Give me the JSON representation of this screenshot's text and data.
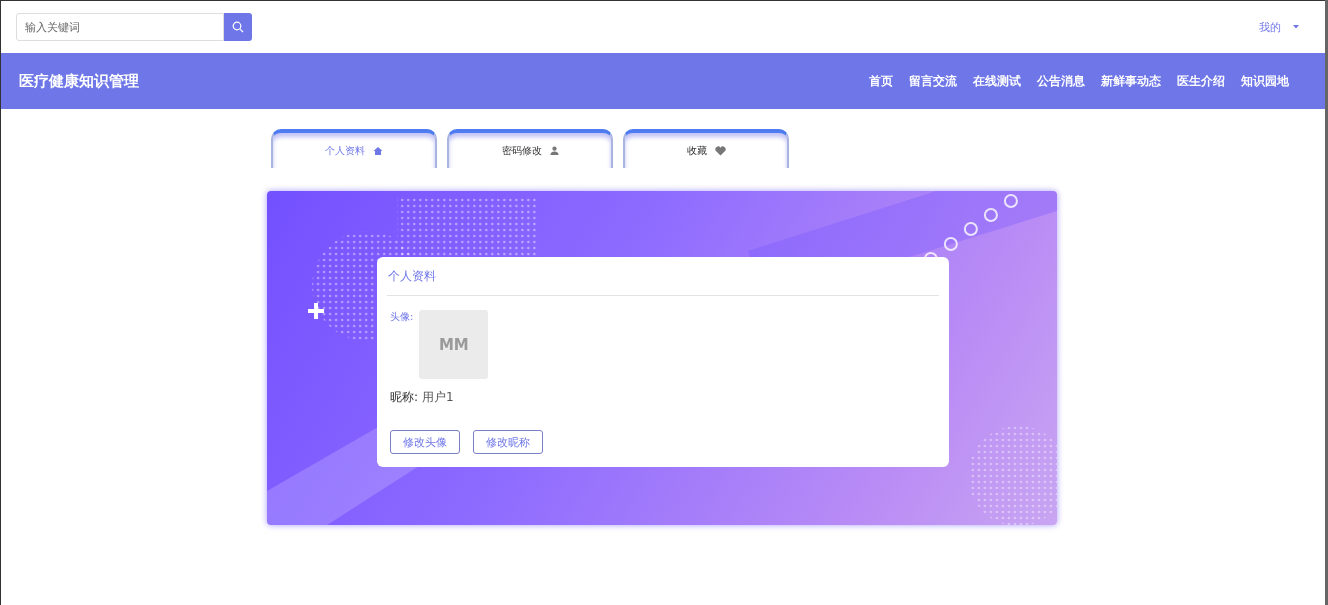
{
  "search": {
    "placeholder": "输入关键词"
  },
  "user_menu": {
    "label": "我的"
  },
  "header": {
    "title": "医疗健康知识管理",
    "nav": [
      {
        "label": "首页"
      },
      {
        "label": "留言交流"
      },
      {
        "label": "在线测试"
      },
      {
        "label": "公告消息"
      },
      {
        "label": "新鲜事动态"
      },
      {
        "label": "医生介绍"
      },
      {
        "label": "知识园地"
      }
    ]
  },
  "tabs": [
    {
      "label": "个人资料",
      "kind": "home",
      "selected": true
    },
    {
      "label": "密码修改",
      "kind": "user",
      "selected": false
    },
    {
      "label": "收藏",
      "kind": "heart",
      "selected": false
    }
  ],
  "profile": {
    "title": "个人资料",
    "avatar_label": "头像:",
    "avatar_text": "MM",
    "nickname_label": "昵称:",
    "nickname": "用户1",
    "buttons": [
      "修改头像",
      "修改昵称"
    ]
  }
}
